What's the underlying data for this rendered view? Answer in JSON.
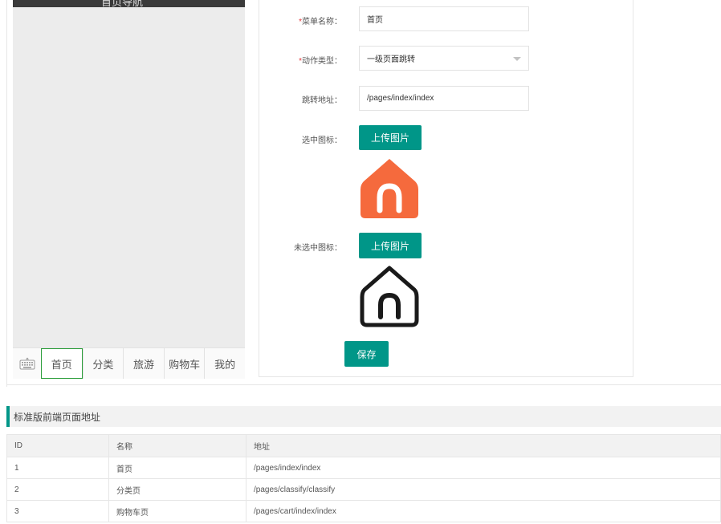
{
  "phone": {
    "title": "首页导航",
    "tabs": [
      "首页",
      "分类",
      "旅游",
      "购物车",
      "我的"
    ],
    "active_tab": "首页"
  },
  "form": {
    "menu_name": {
      "label": "菜单名称：",
      "required_mark": "*",
      "value": "首页"
    },
    "action_type": {
      "label": "动作类型：",
      "required_mark": "*",
      "value": "一级页面跳转"
    },
    "jump_url": {
      "label": "跳转地址：",
      "value": "/pages/index/index"
    },
    "selected_icon": {
      "label": "选中图标：",
      "button": "上传图片",
      "icon": "home-icon-orange-filled"
    },
    "unselected_icon": {
      "label": "未选中图标：",
      "button": "上传图片",
      "icon": "home-icon-black-outline"
    },
    "save_label": "保存"
  },
  "colors": {
    "accent": "#009688",
    "selected_icon": "#F56A3D",
    "active_tab_border": "#2A9D3A"
  },
  "section_title": "标准版前端页面地址",
  "table": {
    "columns": [
      "ID",
      "名称",
      "地址"
    ],
    "rows": [
      [
        "1",
        "首页",
        "/pages/index/index"
      ],
      [
        "2",
        "分类页",
        "/pages/classify/classify"
      ],
      [
        "3",
        "购物车页",
        "/pages/cart/index/index"
      ]
    ]
  }
}
